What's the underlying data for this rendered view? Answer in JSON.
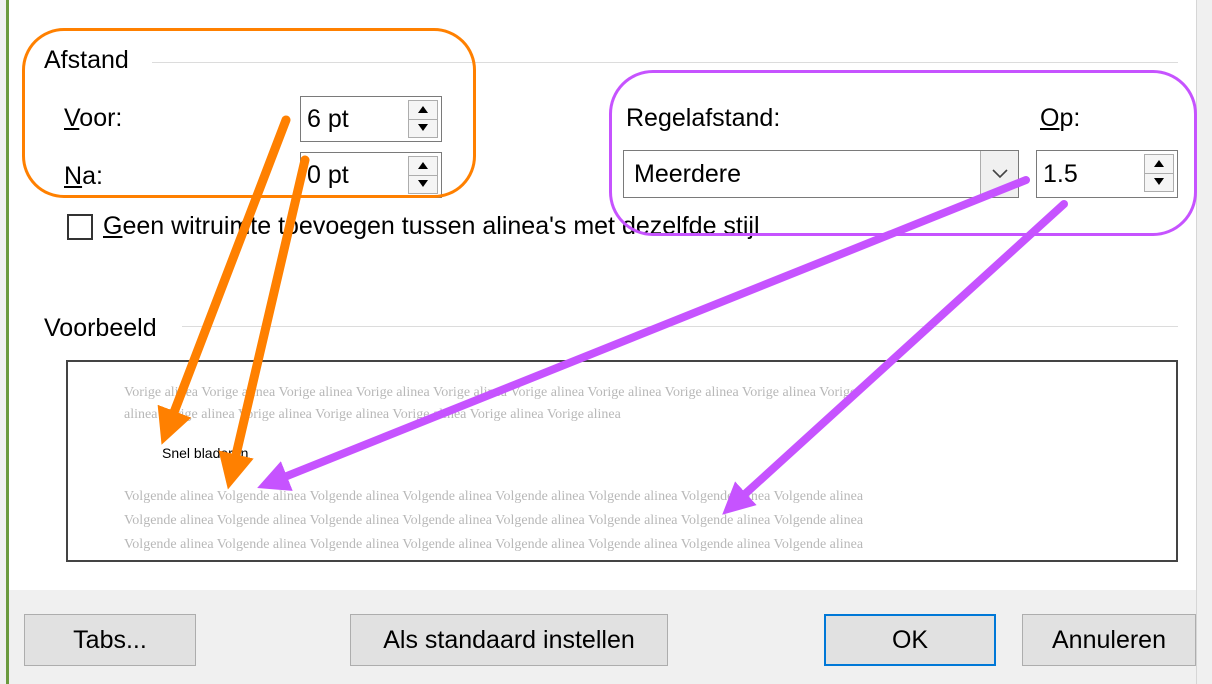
{
  "spacing": {
    "group_title": "Afstand",
    "before_label": "Voor:",
    "before_value": "6 pt",
    "after_label": "Na:",
    "after_value": "0 pt",
    "line_spacing_label": "Regelafstand:",
    "line_spacing_value": "Meerdere",
    "at_label": "Op:",
    "at_value": "1.5",
    "no_space_checkbox_label": "Geen witruimte toevoegen tussen alinea's met dezelfde stijl",
    "no_space_checked": false
  },
  "preview": {
    "group_title": "Voorbeeld",
    "previous_lines": [
      "Vorige alinea Vorige alinea Vorige alinea Vorige alinea Vorige alinea Vorige alinea Vorige alinea Vorige alinea Vorige alinea Vorige",
      "alinea Vorige alinea Vorige alinea Vorige alinea Vorige alinea Vorige alinea Vorige alinea"
    ],
    "sample_text": "Snel bladeren",
    "next_lines": [
      "Volgende alinea Volgende alinea Volgende alinea Volgende alinea Volgende alinea Volgende alinea Volgende alinea Volgende alinea",
      "Volgende alinea Volgende alinea Volgende alinea Volgende alinea Volgende alinea Volgende alinea Volgende alinea Volgende alinea",
      "Volgende alinea Volgende alinea Volgende alinea Volgende alinea Volgende alinea Volgende alinea Volgende alinea Volgende alinea"
    ]
  },
  "buttons": {
    "tabs": "Tabs...",
    "set_default": "Als standaard instellen",
    "ok": "OK",
    "cancel": "Annuleren"
  },
  "annotations": {
    "orange_color": "#ff8000",
    "purple_color": "#c653ff"
  }
}
